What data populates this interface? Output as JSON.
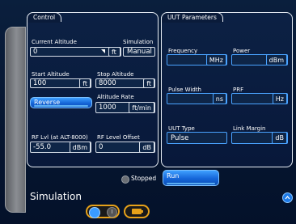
{
  "control_panel": {
    "title": "Control",
    "current_altitude": {
      "label": "Current Altitude",
      "value": "0",
      "unit": "ft"
    },
    "simulation": {
      "label": "Simulation",
      "value": "Manual"
    },
    "start_altitude": {
      "label": "Start Altitude",
      "value": "100",
      "unit": "ft"
    },
    "stop_altitude": {
      "label": "Stop Altitude",
      "value": "8000",
      "unit": "ft"
    },
    "reverse_button": "Reverse",
    "altitude_rate": {
      "label": "Altitude Rate",
      "value": "1000",
      "unit": "ft/min"
    },
    "rf_level": {
      "label": "RF Lvl (at ALT-8000)",
      "value": "-55.0",
      "unit": "dBm"
    },
    "rf_offset": {
      "label": "RF Level Offset",
      "value": "0",
      "unit": "dB"
    }
  },
  "uut_panel": {
    "title": "UUT Parameters",
    "frequency": {
      "label": "Frequency",
      "value": "",
      "unit": "MHz"
    },
    "power": {
      "label": "Power",
      "value": "",
      "unit": "dBm"
    },
    "pulse_width": {
      "label": "Pulse Width",
      "value": "",
      "unit": "ns"
    },
    "prf": {
      "label": "PRF",
      "value": "",
      "unit": "Hz"
    },
    "uut_type": {
      "label": "UUT Type",
      "value": "Pulse"
    },
    "link_margin": {
      "label": "Link Margin",
      "value": "",
      "unit": "dB"
    }
  },
  "status": {
    "label": "Stopped",
    "color": "#6b6f75"
  },
  "run_button": "Run",
  "footer": {
    "title": "Simulation"
  },
  "colors": {
    "accent": "#1e7ae6",
    "panel_border": "#e8eef6",
    "background": "#061630"
  }
}
